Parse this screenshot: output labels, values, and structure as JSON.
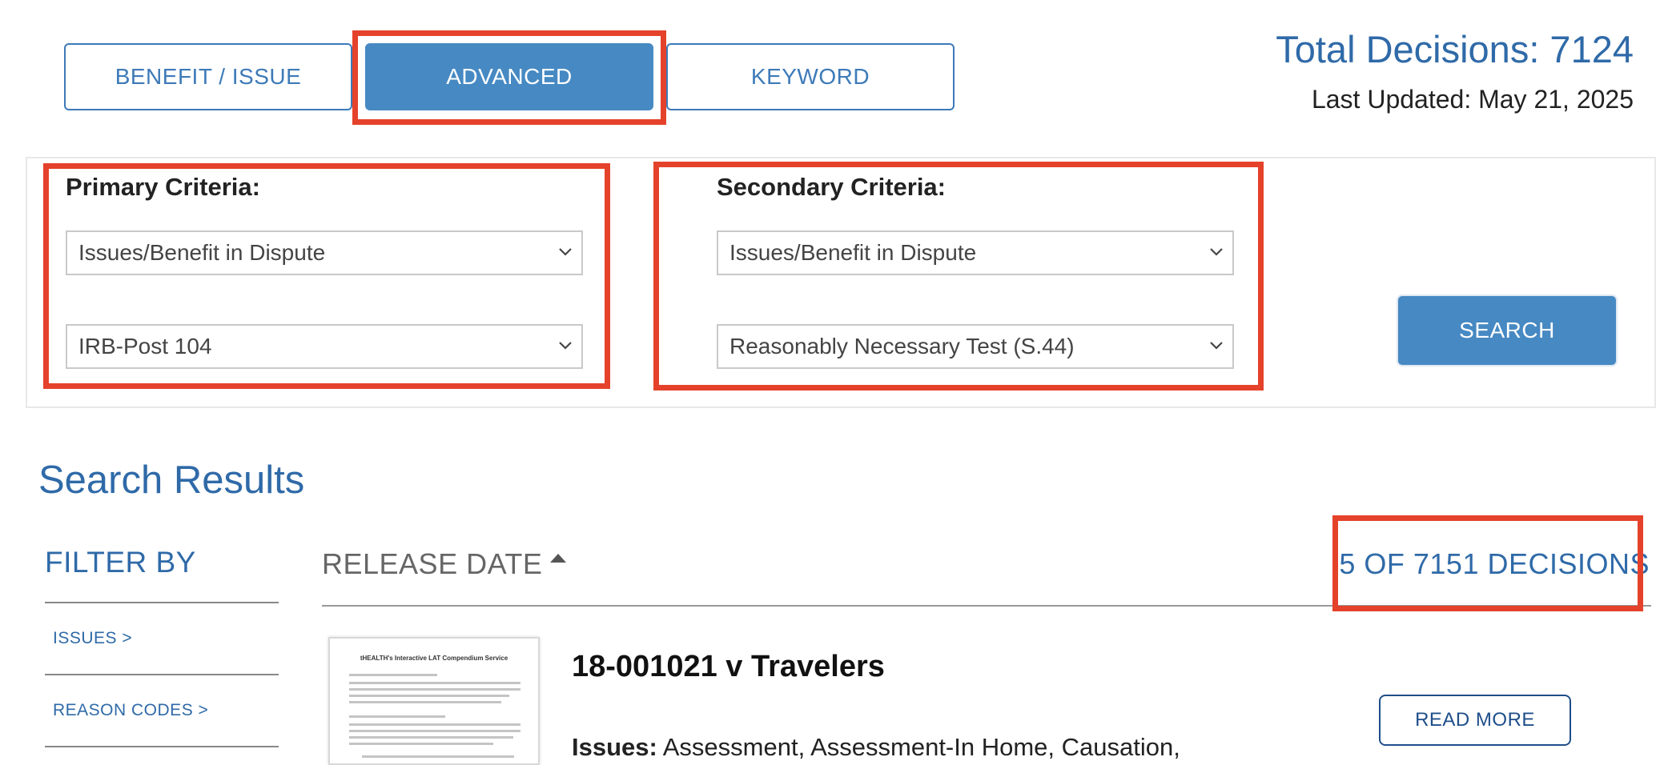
{
  "tabs": [
    {
      "label": "BENEFIT / ISSUE"
    },
    {
      "label": "ADVANCED"
    },
    {
      "label": "KEYWORD"
    }
  ],
  "stats": {
    "total_decisions": "Total Decisions: 7124",
    "last_updated": "Last Updated: May 21, 2025"
  },
  "criteria": {
    "primary": {
      "label": "Primary Criteria:",
      "field1": "Issues/Benefit in Dispute",
      "field2": "IRB-Post 104"
    },
    "secondary": {
      "label": "Secondary Criteria:",
      "field1": "Issues/Benefit in Dispute",
      "field2": "Reasonably Necessary Test (S.44)"
    },
    "search_label": "SEARCH"
  },
  "results": {
    "title": "Search Results",
    "filter_title": "FILTER BY",
    "filters": [
      "ISSUES >",
      "REASON CODES >"
    ],
    "sort_label": "RELEASE DATE",
    "count_label": "5 OF 7151 DECISIONS",
    "items": [
      {
        "title": "18-001021 v Travelers",
        "issues_label": "Issues:",
        "issues_text": " Assessment, Assessment-In Home, Causation,",
        "read_more": "READ MORE",
        "thumb_heading": "tHEALTH's Interactive LAT Compendium Service"
      }
    ]
  },
  "colors": {
    "accent": "#4689c3",
    "link": "#2f6aa8",
    "highlight": "#e5422b"
  },
  "icons": {
    "select_chevron": "chevron-down-icon",
    "sort": "sort-ascending-icon"
  }
}
